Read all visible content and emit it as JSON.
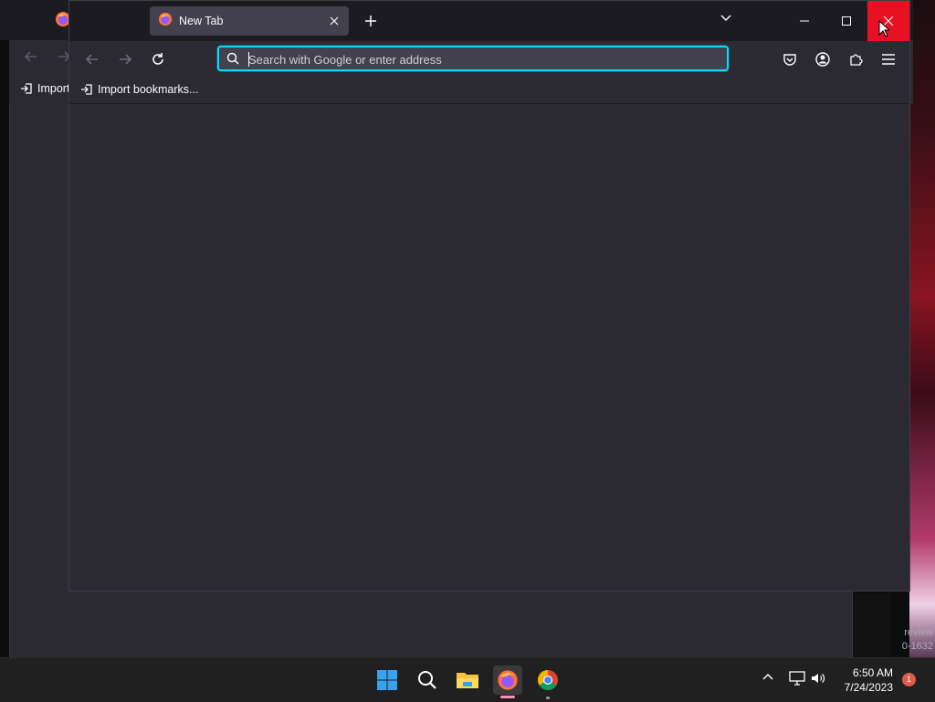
{
  "front_window": {
    "tab": {
      "title": "New Tab"
    },
    "address_bar": {
      "placeholder": "Search with Google or enter address",
      "value": ""
    },
    "bookmarks_toolbar": {
      "import_label": "Import bookmarks..."
    }
  },
  "back_window": {
    "import_label_truncated": "Import"
  },
  "desktop": {
    "preview_text_line1": "review",
    "preview_text_line2": "0-1632"
  },
  "taskbar": {
    "clock_time": "6:50 AM",
    "clock_date": "7/24/2023",
    "notification_count": "1",
    "apps": [
      "start-icon",
      "search-icon",
      "file-explorer-icon",
      "firefox-icon",
      "chrome-icon"
    ]
  },
  "colors": {
    "focus_ring": "#00ddff",
    "close_hover": "#e81123",
    "toolbar_bg": "#2b2a33",
    "titlebar_bg": "#1c1b22"
  }
}
